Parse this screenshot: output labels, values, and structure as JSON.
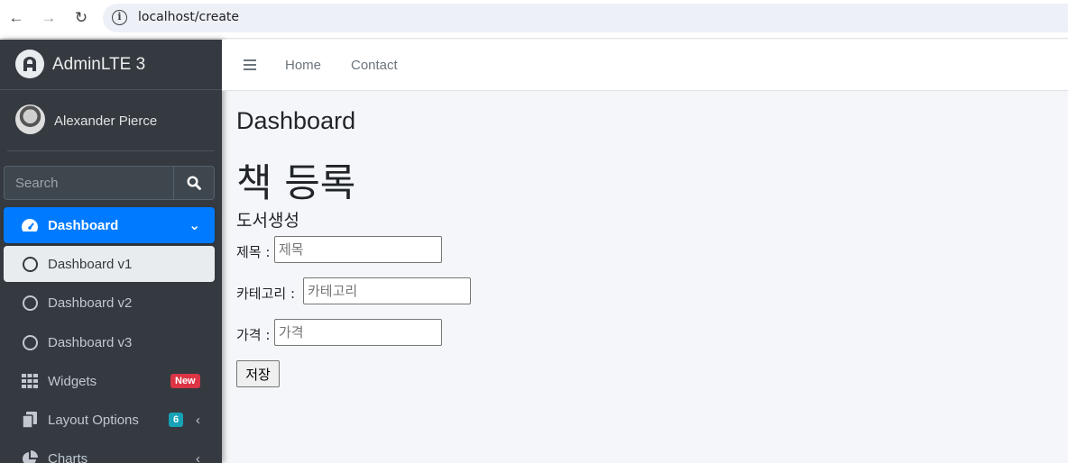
{
  "browser": {
    "url": "localhost/create"
  },
  "sidebar": {
    "brand": "AdminLTE 3",
    "user": "Alexander Pierce",
    "search_placeholder": "Search",
    "items": [
      {
        "label": "Dashboard",
        "icon": "tachometer-icon"
      },
      {
        "label": "Dashboard v1",
        "icon": "circle-icon"
      },
      {
        "label": "Dashboard v2",
        "icon": "circle-icon"
      },
      {
        "label": "Dashboard v3",
        "icon": "circle-icon"
      },
      {
        "label": "Widgets",
        "icon": "grid-icon",
        "badge": "New"
      },
      {
        "label": "Layout Options",
        "icon": "copy-icon",
        "badge": "6"
      },
      {
        "label": "Charts",
        "icon": "pie-chart-icon"
      }
    ]
  },
  "topnav": {
    "home": "Home",
    "contact": "Contact"
  },
  "colors": {
    "accent": "#007bff",
    "sidebar_bg": "#343a40",
    "badge_new": "#dc3545",
    "badge_count": "#17a2b8"
  },
  "main": {
    "page_title": "Dashboard",
    "heading": "책 등록",
    "subheading": "도서생성",
    "form": {
      "title_label": "제목 :",
      "title_placeholder": "제목",
      "category_label": "카테고리 :",
      "category_placeholder": "카테고리",
      "price_label": "가격 :",
      "price_placeholder": "가격",
      "submit": "저장"
    }
  }
}
